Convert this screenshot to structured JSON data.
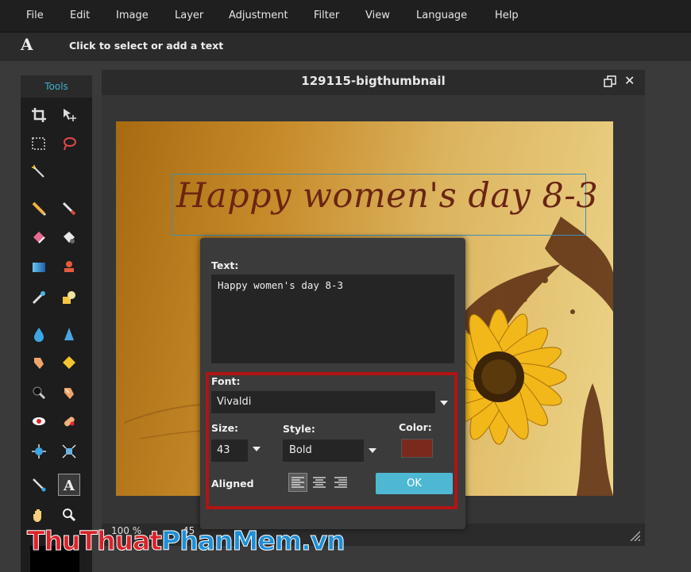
{
  "menu": [
    "File",
    "Edit",
    "Image",
    "Layer",
    "Adjustment",
    "Filter",
    "View",
    "Language",
    "Help"
  ],
  "options_bar": {
    "tool_glyph": "A",
    "hint": "Click to select or add a text"
  },
  "tools_panel": {
    "title": "Tools",
    "active_tool": "text-tool"
  },
  "document": {
    "title": "129115-bigthumbnail",
    "close_glyph": "✕",
    "canvas_text": "Happy women's day 8-3"
  },
  "statusbar": {
    "zoom": "100 %",
    "dimensions": "45"
  },
  "dialog": {
    "text_label": "Text:",
    "text_value": "Happy women's day 8-3",
    "font_label": "Font:",
    "font_value": "Vivaldi",
    "size_label": "Size:",
    "size_value": "43",
    "style_label": "Style:",
    "style_value": "Bold",
    "color_label": "Color:",
    "color_value": "#7a2a1c",
    "aligned_label": "Aligned",
    "align_selected": "left",
    "ok_label": "OK"
  },
  "watermark": {
    "part1": "ThuThuat",
    "part2": "PhanMem.vn"
  },
  "colors": {
    "accent": "#4eb8d2",
    "highlight": "#b31313",
    "tools_title": "#3fb0d0",
    "text_frame": "#3c8fb8"
  }
}
